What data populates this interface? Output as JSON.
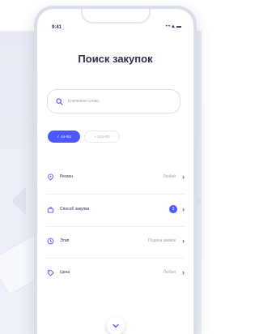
{
  "status": {
    "time": "9:41",
    "icons": "••▲▬"
  },
  "header": {
    "title": "Поиск закупок"
  },
  "search": {
    "placeholder": "Ключевое слово"
  },
  "filters": {
    "chips": [
      {
        "label": "✓ 44-ФЗ",
        "active": true
      },
      {
        "label": "+ 223-ФЗ",
        "active": false
      }
    ]
  },
  "rows": [
    {
      "label": "Регион",
      "value": "Любой",
      "icon": "location-pin-icon"
    },
    {
      "label": "Способ закупки",
      "badge": "3",
      "icon": "shopping-bag-icon"
    },
    {
      "label": "Этап",
      "value": "Подача заявок",
      "icon": "clock-icon"
    },
    {
      "label": "Цена",
      "value": "Любая",
      "icon": "price-tag-icon"
    }
  ],
  "colors": {
    "accent": "#4b58ff",
    "text": "#2b2f45",
    "muted": "#9aa1b3",
    "background": "#e7ebf5"
  }
}
